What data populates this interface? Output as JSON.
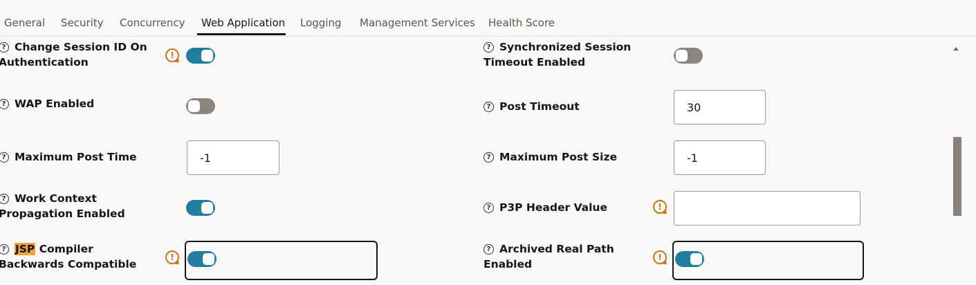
{
  "tabs": [
    {
      "label": "General"
    },
    {
      "label": "Security"
    },
    {
      "label": "Concurrency"
    },
    {
      "label": "Web Application",
      "active": true
    },
    {
      "label": "Logging"
    },
    {
      "label": "Management Services"
    },
    {
      "label": "Health Score"
    }
  ],
  "fields": {
    "change_session_id": {
      "line1": "Change Session ID On",
      "line2": "Authentication",
      "enabled": true
    },
    "sync_session_timeout": {
      "line1": "Synchronized Session",
      "line2": "Timeout Enabled",
      "enabled": false
    },
    "wap_enabled": {
      "label": "WAP Enabled",
      "enabled": false
    },
    "post_timeout": {
      "label": "Post Timeout",
      "value": "30"
    },
    "max_post_time": {
      "label": "Maximum Post Time",
      "value": "-1"
    },
    "max_post_size": {
      "label": "Maximum Post Size",
      "value": "-1"
    },
    "work_context": {
      "line1": "Work Context",
      "line2": "Propagation Enabled",
      "enabled": true
    },
    "p3p_header": {
      "label": "P3P Header Value",
      "value": ""
    },
    "jsp_compiler": {
      "highlight": "JSP",
      "line1_rest": " Compiler",
      "line2": "Backwards Compatible",
      "enabled": true
    },
    "archived_real_path": {
      "line1": "Archived Real Path",
      "line2": "Enabled",
      "enabled": true
    }
  },
  "icons": {
    "help": "?",
    "warning": "!"
  },
  "colors": {
    "toggle_on": "#227e9e",
    "toggle_off": "#8b8580",
    "warning": "#c7741a",
    "highlight": "#f0a140"
  }
}
